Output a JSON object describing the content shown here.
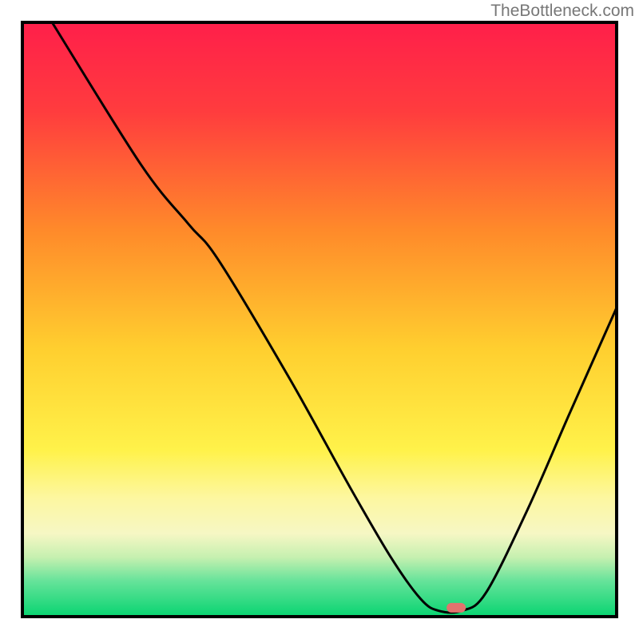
{
  "watermark": "TheBottleneck.com",
  "chart_data": {
    "type": "line",
    "title": "",
    "xlabel": "",
    "ylabel": "",
    "xlim": [
      0,
      100
    ],
    "ylim": [
      0,
      100
    ],
    "gradient_stops": [
      {
        "offset": 0,
        "color": "#ff1f4a"
      },
      {
        "offset": 15,
        "color": "#ff3c3e"
      },
      {
        "offset": 35,
        "color": "#ff8a2a"
      },
      {
        "offset": 55,
        "color": "#ffcf2f"
      },
      {
        "offset": 72,
        "color": "#fff24a"
      },
      {
        "offset": 80,
        "color": "#fdf7a0"
      },
      {
        "offset": 86,
        "color": "#f6f7c4"
      },
      {
        "offset": 90,
        "color": "#c6f0b0"
      },
      {
        "offset": 94,
        "color": "#66e39a"
      },
      {
        "offset": 100,
        "color": "#08d471"
      }
    ],
    "series": [
      {
        "name": "bottleneck-curve",
        "points": [
          {
            "x": 5,
            "y": 100
          },
          {
            "x": 20,
            "y": 76
          },
          {
            "x": 28,
            "y": 66
          },
          {
            "x": 33,
            "y": 60
          },
          {
            "x": 45,
            "y": 40
          },
          {
            "x": 55,
            "y": 22
          },
          {
            "x": 62,
            "y": 10
          },
          {
            "x": 67,
            "y": 3
          },
          {
            "x": 70,
            "y": 1
          },
          {
            "x": 74,
            "y": 1
          },
          {
            "x": 78,
            "y": 4
          },
          {
            "x": 85,
            "y": 18
          },
          {
            "x": 92,
            "y": 34
          },
          {
            "x": 100,
            "y": 52
          }
        ]
      }
    ],
    "marker": {
      "x": 73,
      "y": 1.5,
      "color": "#e2736e"
    }
  }
}
